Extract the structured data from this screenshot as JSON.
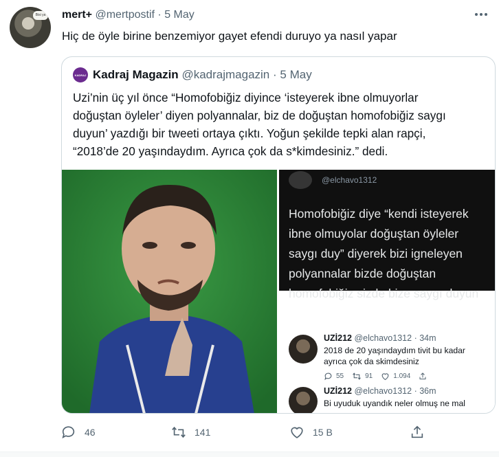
{
  "tweet": {
    "author_name": "mert+",
    "author_handle": "@mertpostif",
    "separator": "·",
    "date": "5 May",
    "avatar_bubble": "Bisi ya",
    "text": "Hiç de öyle birine benzemiyor gayet efendi duruyo ya nasıl yapar",
    "more_icon": "more-icon"
  },
  "quote": {
    "logo_text": "KADRAJ",
    "author_name": "Kadraj Magazin",
    "author_handle": "@kadrajmagazin",
    "separator": "·",
    "date": "5 May",
    "lines": [
      "Uzi’nin üç yıl önce “Homofobiğiz diyince ‘isteyerek ibne olmuyorlar",
      "doğuştan öyleler’ diyen polyannalar, biz de doğuştan homofobiğiz saygı",
      "duyun’ yazdığı bir tweeti ortaya çıktı. Yoğun şekilde tepki alan rapçi,",
      "“2018’de 20 yaşındaydım. Ayrıca çok da s*kimdesiniz.” dedi."
    ],
    "media_right": {
      "dark_handle": "@elchavo1312",
      "dark_lines": [
        "Homofobiğiz diye “kendi isteyerek",
        "ibne olmuyolar doğuştan öyleler",
        "saygı duy” diyerek bizi igneleyen",
        "polyannalar bizde doğuştan",
        "homofobiğiz sizde bize saygı duyun"
      ],
      "reply1": {
        "name": "UZİ212",
        "handle": "@elchavo1312",
        "separator": "·",
        "time": "34m",
        "lines": [
          "2018 de 20 yaşındaydım tivit bu kadar",
          "ayrıca çok da skimdesiniz"
        ],
        "replies": "55",
        "retweets": "91",
        "likes": "1.094"
      },
      "reply2": {
        "name": "UZİ212",
        "handle": "@elchavo1312",
        "separator": "·",
        "time": "36m",
        "lines": [
          "Bi uyuduk uyandık neler olmuş ne mal"
        ]
      }
    }
  },
  "actions": {
    "reply_count": "46",
    "retweet_count": "141",
    "like_count": "15 B"
  },
  "colors": {
    "text": "#0f1419",
    "muted": "#536471",
    "border": "#cfd9de",
    "green_bg": "#2f8a3a",
    "dark_bg": "#101010"
  }
}
